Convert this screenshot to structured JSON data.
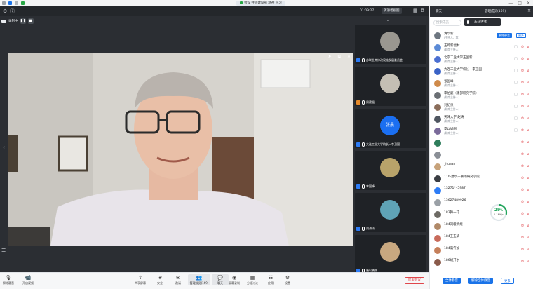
{
  "window": {
    "title_chip": "会议 住房建设部 精神 学习",
    "controls": [
      "—",
      "□",
      "✕"
    ]
  },
  "toolstrip": {
    "timer": "01:09:27",
    "view_button": "演讲者视图"
  },
  "record": {
    "label": "录制中"
  },
  "thumbnails": [
    {
      "name": "苏联赴南修改设施发展委员会",
      "type": "image"
    },
    {
      "name": "周建强",
      "type": "image"
    },
    {
      "name": "大连工业大学校长—李卫国",
      "type": "text",
      "avatar_text": "张晨"
    },
    {
      "name": "李国峰",
      "type": "image"
    },
    {
      "name": "刘海涛",
      "type": "image"
    },
    {
      "name": "唐以晓然",
      "type": "image"
    }
  ],
  "sidebar": {
    "tabs": [
      "聊天",
      "管理成员(169)"
    ],
    "search_placeholder": "搜索成员",
    "speaking": "正在讲话",
    "host_tag": "解除静音",
    "host_more": "更多",
    "participants": [
      {
        "name": "清华新",
        "sub": "(主持人，我)"
      },
      {
        "name": "王跨新福林",
        "sub": "(联席主持人)"
      },
      {
        "name": "北京工业大学王国新",
        "sub": "(联席主持人)"
      },
      {
        "name": "大连工业大学校长—李卫国",
        "sub": "(联席主持人)"
      },
      {
        "name": "张国峰",
        "sub": "(联席主持人)"
      },
      {
        "name": "李伯庭（建部研究学院）",
        "sub": "(联席主持人)"
      },
      {
        "name": "刘纪泉",
        "sub": "(联席主持人)"
      },
      {
        "name": "天津大学 赵涛",
        "sub": "(联席主持人)"
      },
      {
        "name": "夏以娟刚",
        "sub": "(联席主持人)"
      },
      {
        "name": "··",
        "sub": ""
      },
      {
        "name": "· · ·",
        "sub": ""
      },
      {
        "name": "_huaan",
        "sub": ""
      },
      {
        "name": "110-建筑—暴雨研究学院",
        "sub": ""
      },
      {
        "name": "13271*··5987",
        "sub": ""
      },
      {
        "name": "13627489926",
        "sub": ""
      },
      {
        "name": "183舞一巧",
        "sub": ""
      },
      {
        "name": "184刘峻新规",
        "sub": ""
      },
      {
        "name": "184王玉华",
        "sub": ""
      },
      {
        "name": "184满许加",
        "sub": ""
      },
      {
        "name": "186胡开尔",
        "sub": ""
      }
    ],
    "network": {
      "percent": "29",
      "percent_unit": "%",
      "speed": "1.1Mb/s",
      "level": 0.29
    },
    "actions": {
      "mute_all": "全体静音",
      "unmute_all": "解除全体静音",
      "more": "更多"
    }
  },
  "bottombar": {
    "left": [
      {
        "label": "解除静音",
        "icon": "mic-icon"
      },
      {
        "label": "开启视频",
        "icon": "camera-icon"
      }
    ],
    "center": [
      {
        "label": "共享屏幕",
        "icon": "share-icon"
      },
      {
        "label": "安全",
        "icon": "shield-icon"
      },
      {
        "label": "邀请",
        "icon": "invite-icon"
      },
      {
        "label": "管理成员(169)",
        "icon": "members-icon"
      },
      {
        "label": "聊天",
        "icon": "chat-icon"
      },
      {
        "label": "屏幕录制",
        "icon": "record-icon"
      },
      {
        "label": "分组讨论",
        "icon": "group-icon"
      },
      {
        "label": "应用",
        "icon": "apps-icon"
      },
      {
        "label": "设置",
        "icon": "settings-icon"
      }
    ],
    "leave": "结束会议"
  }
}
